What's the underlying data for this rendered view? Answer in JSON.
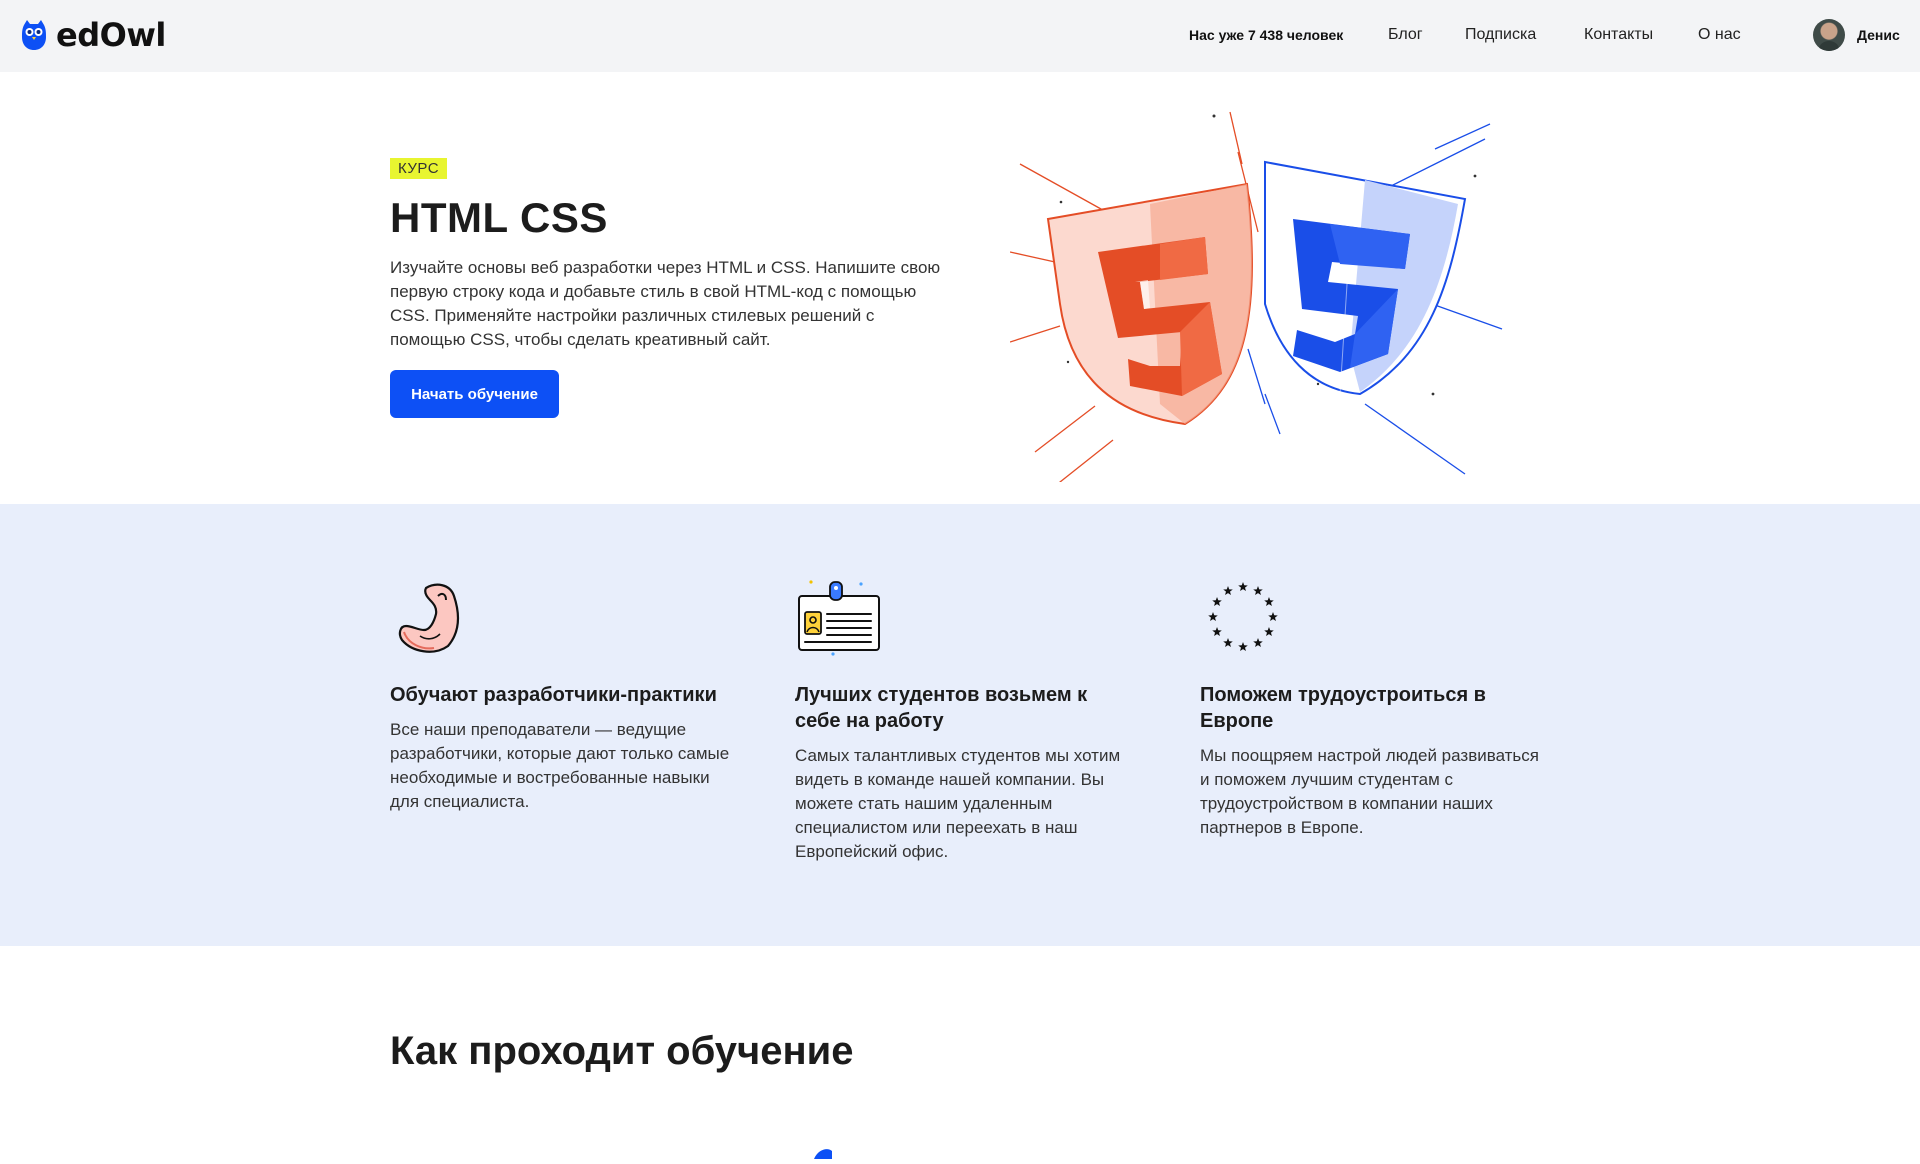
{
  "header": {
    "logo_text": "edOwl",
    "counter": "Нас уже 7 438 человек",
    "nav": [
      "Блог",
      "Подписка",
      "Контакты",
      "О нас"
    ],
    "user_name": "Денис"
  },
  "hero": {
    "badge": "КУРС",
    "title": "HTML CSS",
    "description": "Изучайте основы веб разработки через HTML и CSS. Напишите свою первую строку кода и добавьте стиль в свой HTML-код с помощью CSS. Применяйте настройки различных стилевых решений с помощью CSS, чтобы сделать креативный сайт.",
    "cta_label": "Начать обучение"
  },
  "features": [
    {
      "icon": "flexed-arm-icon",
      "title": "Обучают разработчики-практики",
      "text": "Все наши преподаватели — ведущие разработчики, которые дают только самые необходимые и востребованные навыки для специалиста."
    },
    {
      "icon": "id-badge-icon",
      "title": "Лучших студентов возьмем к себе на работу",
      "text": "Самых талантливых студентов мы хотим видеть в команде нашей компании. Вы можете стать нашим удаленным специалистом или переехать в наш Европейский офис."
    },
    {
      "icon": "eu-stars-icon",
      "title": "Поможем трудоустроиться в Европе",
      "text": "Мы поощряем настрой людей развиваться и поможем лучшим студентам с трудоустройством в компании наших партнеров в Европе."
    }
  ],
  "how": {
    "title": "Как проходит обучение"
  },
  "colors": {
    "accent": "#0d50f5",
    "badge": "#e8f530",
    "features_bg": "#e8eefb",
    "html5": "#e44d26",
    "css3": "#1a4ee8"
  }
}
